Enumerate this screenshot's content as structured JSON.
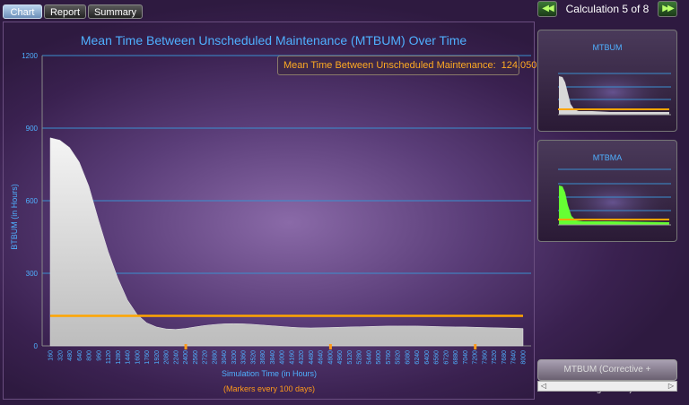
{
  "tabs": [
    {
      "label": "Chart",
      "active": true
    },
    {
      "label": "Report",
      "active": false
    },
    {
      "label": "Summary",
      "active": false
    }
  ],
  "nav": {
    "calc_label": "Calculation 5 of 8",
    "prev_icon": "double-left-arrow-icon",
    "next_icon": "double-right-arrow-icon"
  },
  "tooltip": {
    "label": "Mean Time Between Unscheduled Maintenance:",
    "value": "124.050"
  },
  "side_panels": [
    {
      "title": "MTBUM"
    },
    {
      "title": "MTBMA"
    }
  ],
  "bottom_button": {
    "label": "MTBUM (Corrective + Prognostics)"
  },
  "colors": {
    "accent_blue": "#4fb0ff",
    "mean_line": "#ffa500",
    "marker_orange": "#ff9a1a",
    "mtbma_green": "#66ff33"
  },
  "chart_data": {
    "type": "area",
    "title": "Mean Time Between Unscheduled Maintenance (MTBUM) Over Time",
    "xlabel": "Simulation Time (in Hours)",
    "x_sublabel": "(Markers every 100 days)",
    "ylabel": "BTBUM (in Hours)",
    "ylim": [
      0,
      1200
    ],
    "yticks": [
      0,
      300,
      600,
      900,
      1200
    ],
    "grid": true,
    "x": [
      160,
      320,
      480,
      640,
      800,
      960,
      1120,
      1280,
      1440,
      1600,
      1760,
      1920,
      2080,
      2240,
      2400,
      2560,
      2720,
      2880,
      3040,
      3200,
      3360,
      3520,
      3680,
      3840,
      4000,
      4160,
      4320,
      4480,
      4640,
      4800,
      4960,
      5120,
      5280,
      5440,
      5600,
      5760,
      5920,
      6080,
      6240,
      6400,
      6560,
      6720,
      6880,
      7040,
      7200,
      7360,
      7520,
      7680,
      7840,
      8000
    ],
    "series": [
      {
        "type": "area",
        "values": [
          860,
          850,
          820,
          760,
          660,
          520,
          390,
          280,
          190,
          130,
          95,
          78,
          70,
          68,
          72,
          78,
          84,
          88,
          91,
          92,
          91,
          89,
          86,
          83,
          80,
          77,
          75,
          74,
          75,
          76,
          77,
          78,
          79,
          80,
          81,
          82,
          82,
          82,
          82,
          81,
          80,
          79,
          78,
          78,
          77,
          76,
          75,
          74,
          73,
          72
        ]
      },
      {
        "type": "line",
        "name": "Mean Time Between Unscheduled Maintenance",
        "constant": 124.05
      }
    ],
    "markers_x": [
      2400,
      4800,
      7200
    ]
  }
}
